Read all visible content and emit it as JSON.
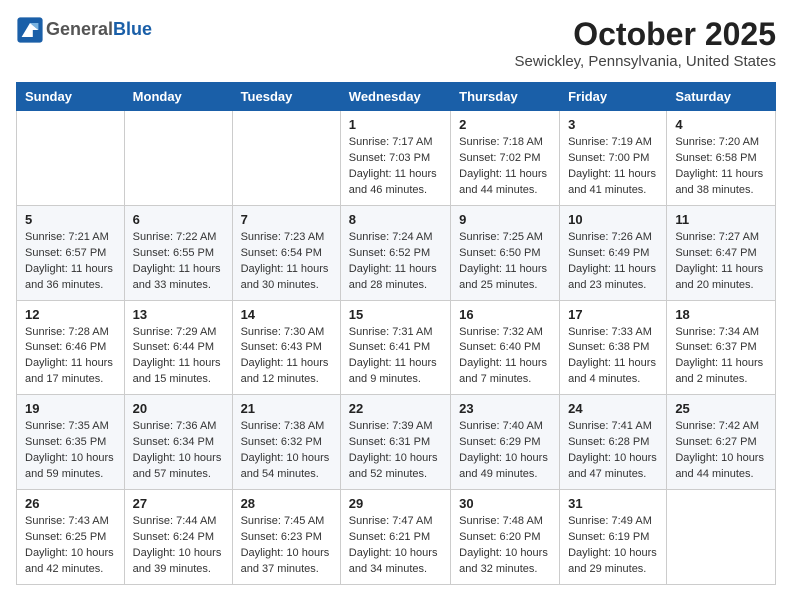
{
  "header": {
    "logo_general": "General",
    "logo_blue": "Blue",
    "title": "October 2025",
    "subtitle": "Sewickley, Pennsylvania, United States"
  },
  "days_of_week": [
    "Sunday",
    "Monday",
    "Tuesday",
    "Wednesday",
    "Thursday",
    "Friday",
    "Saturday"
  ],
  "weeks": [
    [
      {
        "day": "",
        "info": ""
      },
      {
        "day": "",
        "info": ""
      },
      {
        "day": "",
        "info": ""
      },
      {
        "day": "1",
        "info": "Sunrise: 7:17 AM\nSunset: 7:03 PM\nDaylight: 11 hours and 46 minutes."
      },
      {
        "day": "2",
        "info": "Sunrise: 7:18 AM\nSunset: 7:02 PM\nDaylight: 11 hours and 44 minutes."
      },
      {
        "day": "3",
        "info": "Sunrise: 7:19 AM\nSunset: 7:00 PM\nDaylight: 11 hours and 41 minutes."
      },
      {
        "day": "4",
        "info": "Sunrise: 7:20 AM\nSunset: 6:58 PM\nDaylight: 11 hours and 38 minutes."
      }
    ],
    [
      {
        "day": "5",
        "info": "Sunrise: 7:21 AM\nSunset: 6:57 PM\nDaylight: 11 hours and 36 minutes."
      },
      {
        "day": "6",
        "info": "Sunrise: 7:22 AM\nSunset: 6:55 PM\nDaylight: 11 hours and 33 minutes."
      },
      {
        "day": "7",
        "info": "Sunrise: 7:23 AM\nSunset: 6:54 PM\nDaylight: 11 hours and 30 minutes."
      },
      {
        "day": "8",
        "info": "Sunrise: 7:24 AM\nSunset: 6:52 PM\nDaylight: 11 hours and 28 minutes."
      },
      {
        "day": "9",
        "info": "Sunrise: 7:25 AM\nSunset: 6:50 PM\nDaylight: 11 hours and 25 minutes."
      },
      {
        "day": "10",
        "info": "Sunrise: 7:26 AM\nSunset: 6:49 PM\nDaylight: 11 hours and 23 minutes."
      },
      {
        "day": "11",
        "info": "Sunrise: 7:27 AM\nSunset: 6:47 PM\nDaylight: 11 hours and 20 minutes."
      }
    ],
    [
      {
        "day": "12",
        "info": "Sunrise: 7:28 AM\nSunset: 6:46 PM\nDaylight: 11 hours and 17 minutes."
      },
      {
        "day": "13",
        "info": "Sunrise: 7:29 AM\nSunset: 6:44 PM\nDaylight: 11 hours and 15 minutes."
      },
      {
        "day": "14",
        "info": "Sunrise: 7:30 AM\nSunset: 6:43 PM\nDaylight: 11 hours and 12 minutes."
      },
      {
        "day": "15",
        "info": "Sunrise: 7:31 AM\nSunset: 6:41 PM\nDaylight: 11 hours and 9 minutes."
      },
      {
        "day": "16",
        "info": "Sunrise: 7:32 AM\nSunset: 6:40 PM\nDaylight: 11 hours and 7 minutes."
      },
      {
        "day": "17",
        "info": "Sunrise: 7:33 AM\nSunset: 6:38 PM\nDaylight: 11 hours and 4 minutes."
      },
      {
        "day": "18",
        "info": "Sunrise: 7:34 AM\nSunset: 6:37 PM\nDaylight: 11 hours and 2 minutes."
      }
    ],
    [
      {
        "day": "19",
        "info": "Sunrise: 7:35 AM\nSunset: 6:35 PM\nDaylight: 10 hours and 59 minutes."
      },
      {
        "day": "20",
        "info": "Sunrise: 7:36 AM\nSunset: 6:34 PM\nDaylight: 10 hours and 57 minutes."
      },
      {
        "day": "21",
        "info": "Sunrise: 7:38 AM\nSunset: 6:32 PM\nDaylight: 10 hours and 54 minutes."
      },
      {
        "day": "22",
        "info": "Sunrise: 7:39 AM\nSunset: 6:31 PM\nDaylight: 10 hours and 52 minutes."
      },
      {
        "day": "23",
        "info": "Sunrise: 7:40 AM\nSunset: 6:29 PM\nDaylight: 10 hours and 49 minutes."
      },
      {
        "day": "24",
        "info": "Sunrise: 7:41 AM\nSunset: 6:28 PM\nDaylight: 10 hours and 47 minutes."
      },
      {
        "day": "25",
        "info": "Sunrise: 7:42 AM\nSunset: 6:27 PM\nDaylight: 10 hours and 44 minutes."
      }
    ],
    [
      {
        "day": "26",
        "info": "Sunrise: 7:43 AM\nSunset: 6:25 PM\nDaylight: 10 hours and 42 minutes."
      },
      {
        "day": "27",
        "info": "Sunrise: 7:44 AM\nSunset: 6:24 PM\nDaylight: 10 hours and 39 minutes."
      },
      {
        "day": "28",
        "info": "Sunrise: 7:45 AM\nSunset: 6:23 PM\nDaylight: 10 hours and 37 minutes."
      },
      {
        "day": "29",
        "info": "Sunrise: 7:47 AM\nSunset: 6:21 PM\nDaylight: 10 hours and 34 minutes."
      },
      {
        "day": "30",
        "info": "Sunrise: 7:48 AM\nSunset: 6:20 PM\nDaylight: 10 hours and 32 minutes."
      },
      {
        "day": "31",
        "info": "Sunrise: 7:49 AM\nSunset: 6:19 PM\nDaylight: 10 hours and 29 minutes."
      },
      {
        "day": "",
        "info": ""
      }
    ]
  ]
}
